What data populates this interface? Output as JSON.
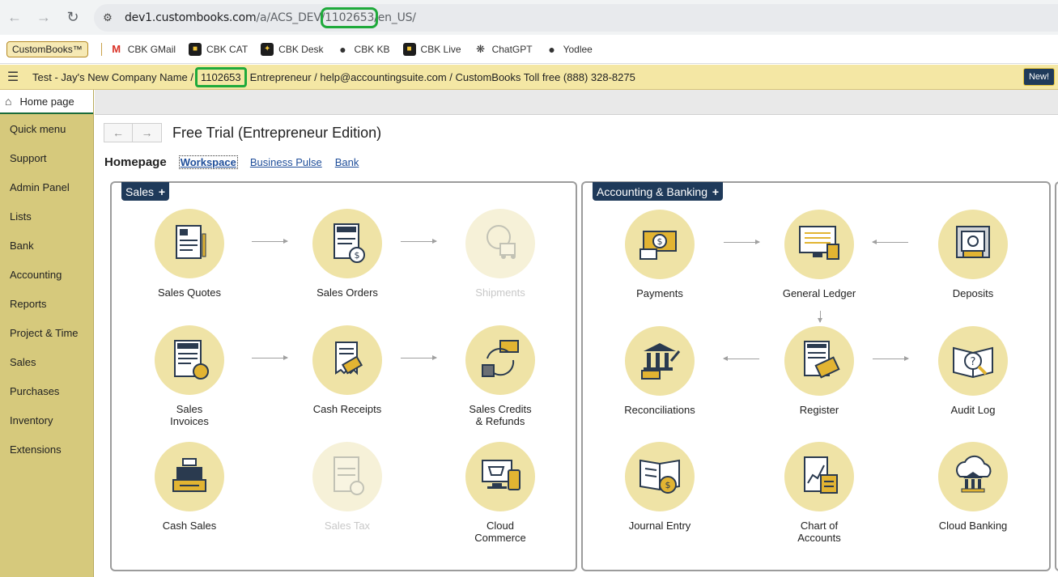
{
  "browser": {
    "url_host": "dev1.custombooks.com",
    "url_path_before": "/a/ACS_DEV/",
    "url_highlight": "1102653",
    "url_path_after": "/en_US/",
    "back_icon": "back-arrow-icon",
    "forward_icon": "forward-arrow-icon",
    "reload_icon": "reload-icon"
  },
  "bookmarks": {
    "brand": "CustomBooks™",
    "items": [
      {
        "label": "CBK GMail",
        "icon": "gmail-icon"
      },
      {
        "label": "CBK CAT",
        "icon": "cbk-icon"
      },
      {
        "label": "CBK Desk",
        "icon": "cbk-desk-icon"
      },
      {
        "label": "CBK KB",
        "icon": "globe-icon"
      },
      {
        "label": "CBK Live",
        "icon": "cbk-icon"
      },
      {
        "label": "ChatGPT",
        "icon": "chatgpt-icon"
      },
      {
        "label": "Yodlee",
        "icon": "globe-icon"
      }
    ]
  },
  "header": {
    "company_prefix": "Test - Jay's New Company Name /",
    "company_id": "1102653",
    "rest": "Entrepreneur / help@accountingsuite.com / CustomBooks Toll free (888) 328-8275",
    "new_label": "New!"
  },
  "sidebar": {
    "home_label": "Home page",
    "items": [
      "Quick menu",
      "Support",
      "Admin Panel",
      "Lists",
      "Bank",
      "Accounting",
      "Reports",
      "Project & Time",
      "Sales",
      "Purchases",
      "Inventory",
      "Extensions"
    ]
  },
  "main": {
    "title": "Free Trial (Entrepreneur Edition)",
    "subnav_label": "Homepage",
    "subnav_links": [
      "Workspace",
      "Business Pulse",
      "Bank"
    ]
  },
  "sales_panel": {
    "tag": "Sales",
    "tiles": [
      {
        "label": "Sales Quotes"
      },
      {
        "label": "Sales Orders"
      },
      {
        "label": "Shipments"
      },
      {
        "label_line1": "Sales",
        "label_line2": "Invoices"
      },
      {
        "label": "Cash Receipts"
      },
      {
        "label_line1": "Sales Credits",
        "label_line2": "& Refunds"
      },
      {
        "label": "Cash Sales"
      },
      {
        "label": "Sales Tax"
      },
      {
        "label_line1": "Cloud",
        "label_line2": "Commerce"
      }
    ]
  },
  "acct_panel": {
    "tag": "Accounting & Banking",
    "tiles": [
      {
        "label": "Payments"
      },
      {
        "label": "General Ledger"
      },
      {
        "label": "Deposits"
      },
      {
        "label": "Reconciliations"
      },
      {
        "label": "Register"
      },
      {
        "label": "Audit Log"
      },
      {
        "label": "Journal Entry"
      },
      {
        "label_line1": "Chart of",
        "label_line2": "Accounts"
      },
      {
        "label": "Cloud Banking"
      }
    ]
  },
  "plus_symbol": "+"
}
